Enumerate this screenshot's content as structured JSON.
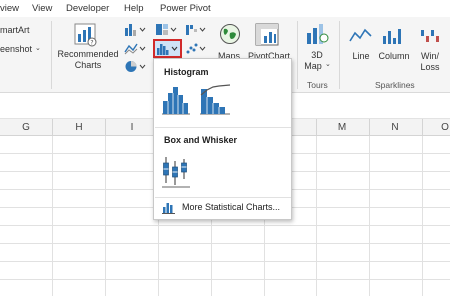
{
  "menu": {
    "tabs": [
      "view",
      "View",
      "Developer",
      "Help",
      "Power Pivot"
    ]
  },
  "ribbon": {
    "smartart_label": "martArt",
    "screenshot_label": "eenshot",
    "recommended_charts_line1": "Recommended",
    "recommended_charts_line2": "Charts",
    "maps_label": "Maps",
    "pivotchart_label": "PivotChart",
    "map3d_line1": "3D",
    "map3d_line2": "Map",
    "tours_label": "Tours",
    "line_label": "Line",
    "column_label": "Column",
    "winloss_line1": "Win/",
    "winloss_line2": "Loss",
    "sparklines_label": "Sparklines"
  },
  "columns": [
    "G",
    "H",
    "I",
    "M",
    "N",
    "O"
  ],
  "dropdown": {
    "histogram_heading": "Histogram",
    "box_whisker_heading": "Box and Whisker",
    "more_label": "More Statistical Charts..."
  },
  "colors": {
    "accent_blue": "#2e75b6",
    "highlight_red": "#d12a2a",
    "selected_bg": "#cfe3f7"
  }
}
